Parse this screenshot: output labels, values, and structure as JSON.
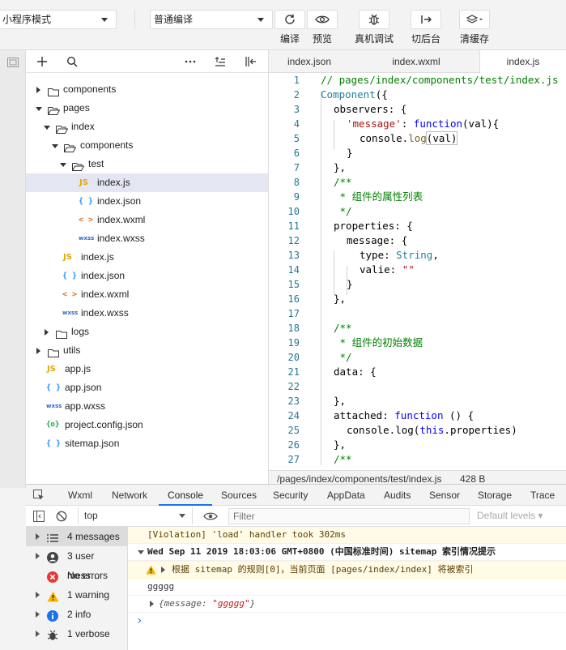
{
  "toolbar": {
    "mode_select": "小程序模式",
    "compile_select": "普通编译",
    "tools": [
      {
        "icon": "refresh-icon",
        "label": "编译"
      },
      {
        "icon": "eye-icon",
        "label": "预览"
      },
      {
        "icon": "bug-icon",
        "label": "真机调试"
      },
      {
        "icon": "switch-background-icon",
        "label": "切后台"
      },
      {
        "icon": "layers-icon",
        "label": "清缓存"
      }
    ]
  },
  "explorer": {
    "items": [
      {
        "label": "components",
        "type": "folder",
        "expanded": false
      },
      {
        "label": "pages",
        "type": "folder",
        "expanded": true
      },
      {
        "label": "index",
        "type": "folder",
        "expanded": true
      },
      {
        "label": "components",
        "type": "folder",
        "expanded": true
      },
      {
        "label": "test",
        "type": "folder",
        "expanded": true
      },
      {
        "label": "index.js",
        "type": "js",
        "selected": true
      },
      {
        "label": "index.json",
        "type": "json"
      },
      {
        "label": "index.wxml",
        "type": "wxml"
      },
      {
        "label": "index.wxss",
        "type": "wxss"
      },
      {
        "label": "index.js",
        "type": "js"
      },
      {
        "label": "index.json",
        "type": "json"
      },
      {
        "label": "index.wxml",
        "type": "wxml"
      },
      {
        "label": "index.wxss",
        "type": "wxss"
      },
      {
        "label": "logs",
        "type": "folder",
        "expanded": false
      },
      {
        "label": "utils",
        "type": "folder",
        "expanded": false
      },
      {
        "label": "app.js",
        "type": "js"
      },
      {
        "label": "app.json",
        "type": "json"
      },
      {
        "label": "app.wxss",
        "type": "wxss"
      },
      {
        "label": "project.config.json",
        "type": "config"
      },
      {
        "label": "sitemap.json",
        "type": "json"
      }
    ],
    "icon_labels": {
      "js": "JS",
      "json": "{ }",
      "wxml": "< >",
      "wxss": "wxss",
      "config": "{o}"
    }
  },
  "editor": {
    "tabs": [
      "index.json",
      "index.wxml",
      "index.js"
    ],
    "active_tab": "index.js",
    "line_numbers": [
      "1",
      "2",
      "3",
      "4",
      "5",
      "6",
      "7",
      "8",
      "9",
      "10",
      "11",
      "12",
      "13",
      "14",
      "15",
      "16",
      "17",
      "18",
      "19",
      "20",
      "21",
      "22",
      "23",
      "24",
      "25",
      "26",
      "27"
    ],
    "code": {
      "l1": "// pages/index/components/test/index.js",
      "l2a": "Component",
      "l2b": "({",
      "l3": "observers: {",
      "l4a": "'message'",
      "l4b": ": ",
      "l4c": "function",
      "l4d": "(val){",
      "l5a": "console.",
      "l5b": "log",
      "l5c": "(val)",
      "l6": "}",
      "l7": "},",
      "l8": "/**",
      "l9": " * 组件的属性列表",
      "l10": " */",
      "l11": "properties: {",
      "l12": "message: {",
      "l13a": "type: ",
      "l13b": "String",
      "l13c": ",",
      "l14a": "valie: ",
      "l14b": "\"\"",
      "l15": "}",
      "l16": "},",
      "l17": "",
      "l18": "/**",
      "l19": " * 组件的初始数据",
      "l20": " */",
      "l21": "data: {",
      "l22": "",
      "l23": "},",
      "l24a": "attached: ",
      "l24b": "function",
      "l24c": " () {",
      "l25a": "console.log(",
      "l25b": "this",
      "l25c": ".properties)",
      "l26": "},",
      "l27": "/**"
    },
    "status_path": "/pages/index/components/test/index.js",
    "status_size": "428 B"
  },
  "devtools": {
    "tabs": [
      "Wxml",
      "Network",
      "Console",
      "Sources",
      "Security",
      "AppData",
      "Audits",
      "Sensor",
      "Storage",
      "Trace"
    ],
    "active_tab": "Console",
    "context": "top",
    "filter_placeholder": "Filter",
    "levels": "Default levels ▾",
    "sidebar": [
      {
        "label": "4 messages",
        "icon": "list-icon"
      },
      {
        "label": "3 user mess…",
        "icon": "user-icon"
      },
      {
        "label": "No errors",
        "icon": "error-icon"
      },
      {
        "label": "1 warning",
        "icon": "warning-icon"
      },
      {
        "label": "2 info",
        "icon": "info-icon"
      },
      {
        "label": "1 verbose",
        "icon": "bug-icon"
      }
    ],
    "logs": {
      "violation": "[Violation] 'load' handler took 302ms",
      "group_header": "Wed Sep 11 2019 18:03:06 GMT+0800 (中国标准时间) sitemap 索引情况提示",
      "warning": "根据 sitemap 的规则[0]，当前页面 [pages/index/index] 将被索引",
      "plain": "ggggg",
      "object_key": "{message: ",
      "object_val": "\"ggggg\"",
      "object_end": "}",
      "prompt": "›"
    }
  }
}
